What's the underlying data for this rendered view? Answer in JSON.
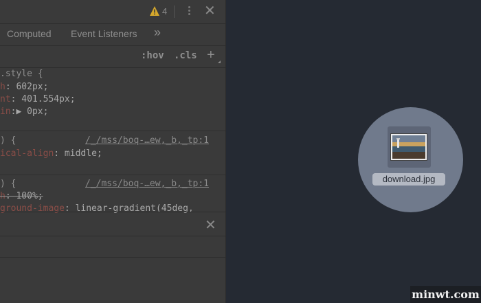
{
  "devtools": {
    "warning_count": "4",
    "tabs": [
      "Computed",
      "Event Listeners",
      "»"
    ],
    "filter": {
      "hov": ":hov",
      "cls": ".cls",
      "plus": "+"
    },
    "element_style": {
      "selector": ".style {",
      "lines": [
        {
          "prop": "h",
          "value": ": 602px;"
        },
        {
          "prop": "nt",
          "value": ": 401.554px;"
        },
        {
          "prop": "in",
          "value": ":▶ 0px;"
        }
      ]
    },
    "rule2": {
      "selector": ") {",
      "source": "/_/mss/boq-…ew,_b,_tp:1",
      "lines": [
        {
          "prop": "ical-align",
          "value": ": middle;"
        }
      ]
    },
    "rule3": {
      "selector": ") {",
      "source": "/_/mss/boq-…ew,_b,_tp:1",
      "lines": [
        {
          "prop": "h",
          "value": ": 100%;"
        },
        {
          "prop": "ground-image",
          "value": ": linear-gradient(45deg,"
        }
      ]
    }
  },
  "drag_preview": {
    "filename": "download.jpg"
  },
  "watermark": "minwt.com"
}
